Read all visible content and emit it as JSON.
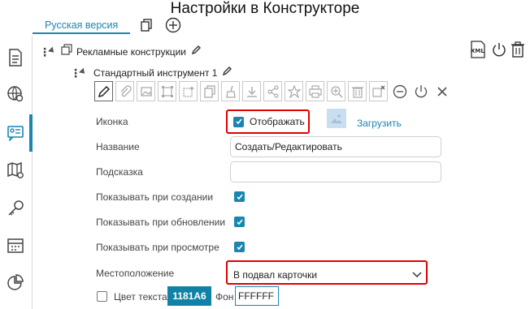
{
  "page": {
    "title": "Настройки в Конструкторе"
  },
  "tabs": {
    "active_label": "Русская версия"
  },
  "tree": {
    "parent_label": "Рекламные конструкции",
    "child_label": "Стандартный инструмент 1"
  },
  "form": {
    "icon": {
      "label": "Иконка",
      "display_label": "Отображать",
      "display_checked": true,
      "upload_label": "Загрузить"
    },
    "name": {
      "label": "Название",
      "value": "Создать/Редактировать"
    },
    "hint": {
      "label": "Подсказка",
      "value": ""
    },
    "show_on_create": {
      "label": "Показывать при создании",
      "checked": true
    },
    "show_on_update": {
      "label": "Показывать при обновлении",
      "checked": true
    },
    "show_on_view": {
      "label": "Показывать при просмотре",
      "checked": true
    },
    "location": {
      "label": "Местоположение",
      "value": "В подвал карточки"
    },
    "text_color": {
      "label": "Цвет текста",
      "checked": false,
      "value": "1181A6"
    },
    "background": {
      "label": "Фон",
      "value": "FFFFFF"
    }
  },
  "colors": {
    "accent": "#1a86b0",
    "highlight": "#e00000",
    "chip": "#1181A6"
  },
  "icons": {
    "rail": [
      "document-icon",
      "globe-settings-icon",
      "card-list-icon",
      "map-settings-icon",
      "key-icon",
      "calendar-grid-icon",
      "pie-chart-icon"
    ],
    "toolbar": [
      "pencil-icon",
      "paperclip-icon",
      "image-area-icon",
      "select-area-icon",
      "magic-select-icon",
      "copy-icon",
      "broom-icon",
      "download-icon",
      "share-icon",
      "star-icon",
      "print-icon",
      "zoom-in-icon",
      "trash-icon",
      "image-remove-icon",
      "minus-circle-icon",
      "power-icon",
      "close-icon"
    ]
  }
}
